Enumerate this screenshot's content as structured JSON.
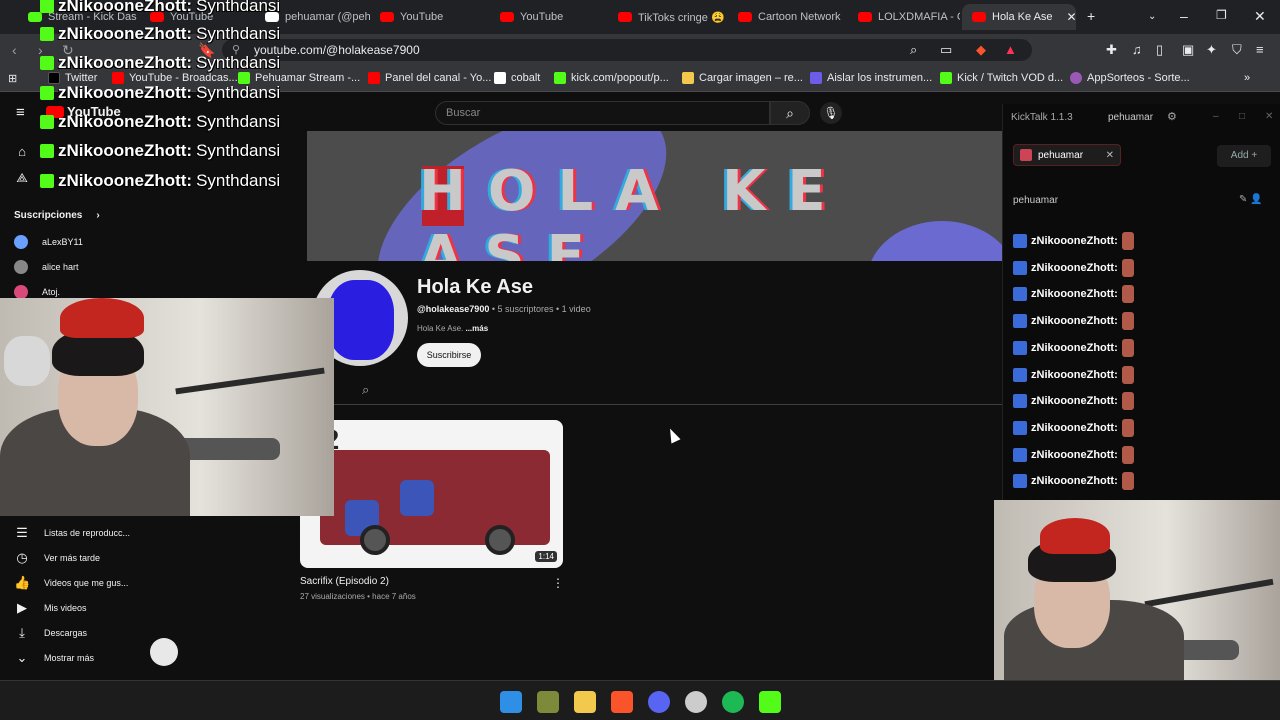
{
  "tabs": [
    {
      "label": "Stream - Kick Das",
      "color": "#53fc18",
      "active": false
    },
    {
      "label": "YouTube",
      "color": "#ff0000",
      "active": false
    },
    {
      "label": "pehuamar (@peh",
      "color": "#ffffff",
      "active": false
    },
    {
      "label": "YouTube",
      "color": "#ff0000",
      "active": false
    },
    {
      "label": "YouTube",
      "color": "#ff0000",
      "active": false
    },
    {
      "label": "TikToks cringe 😩",
      "color": "#ff0000",
      "active": false
    },
    {
      "label": "Cartoon Network",
      "color": "#ff0000",
      "active": false
    },
    {
      "label": "LOLXDMAFIA - C",
      "color": "#ff0000",
      "active": false
    },
    {
      "label": "Hola Ke Ase",
      "color": "#ff0000",
      "active": true
    }
  ],
  "tab_close": "✕",
  "new_tab": "+",
  "address": {
    "url": "youtube.com/@holakease7900"
  },
  "bookmarks": [
    {
      "label": "Twitter",
      "color": "#000000"
    },
    {
      "label": "YouTube - Broadcas...",
      "color": "#ff0000"
    },
    {
      "label": "Pehuamar Stream -...",
      "color": "#53fc18"
    },
    {
      "label": "Panel del canal - Yo...",
      "color": "#ff0000"
    },
    {
      "label": "cobalt",
      "color": "#ffffff"
    },
    {
      "label": "kick.com/popout/p...",
      "color": "#53fc18"
    },
    {
      "label": "Cargar imagen – re...",
      "color": "#f2c94c"
    },
    {
      "label": "Aislar los instrumen...",
      "color": "#6c5ce7"
    },
    {
      "label": "Kick / Twitch VOD d...",
      "color": "#53fc18"
    },
    {
      "label": "AppSorteos - Sorte...",
      "color": "#9b59b6"
    }
  ],
  "youtube": {
    "logo": "YouTube",
    "search_placeholder": "Buscar"
  },
  "overlay": {
    "user": "zNikoooneZhott:",
    "message": "Synthdansi",
    "count": 7
  },
  "sidebar": {
    "subs_title": "Suscripciones",
    "subs": [
      {
        "name": "aLexBY11",
        "color": "#6aa0ff"
      },
      {
        "name": "alice hart",
        "color": "#888888"
      },
      {
        "name": "Atoj.",
        "color": "#d94a7a"
      }
    ],
    "items": [
      {
        "label": "Listas de reproducc...",
        "icon": "playlist-icon"
      },
      {
        "label": "Ver más tarde",
        "icon": "clock-icon"
      },
      {
        "label": "Videos que me gus...",
        "icon": "thumbs-up-icon"
      },
      {
        "label": "Mis videos",
        "icon": "video-icon"
      },
      {
        "label": "Descargas",
        "icon": "download-icon"
      },
      {
        "label": "Mostrar más",
        "icon": "chevron-down-icon"
      }
    ]
  },
  "banner": {
    "text": "HOLA KE ASE"
  },
  "channel": {
    "name": "Hola Ke Ase",
    "handle": "@holakease7900",
    "subscribers": "5 suscriptores",
    "videos": "1 video",
    "description": "Hola Ke Ase.",
    "more": "...más",
    "subscribe_label": "Suscribirse"
  },
  "video": {
    "title": "Sacrifix (Episodio 2)",
    "meta": "27 visualizaciones • hace 7 años",
    "duration": "1:14",
    "thumb_label": "#2"
  },
  "kicktalk": {
    "title": "KickTalk 1.1.3",
    "user": "pehuamar",
    "tab_label": "pehuamar",
    "add_label": "Add +",
    "channel": "pehuamar",
    "message_user": "zNikoooneZhott:",
    "rows": 10
  },
  "taskbar": [
    {
      "name": "windows-start",
      "color": "#2f8fe6"
    },
    {
      "name": "app-2",
      "color": "#7c8a3a"
    },
    {
      "name": "file-explorer",
      "color": "#f2c94c"
    },
    {
      "name": "brave-browser",
      "color": "#fb542b"
    },
    {
      "name": "discord",
      "color": "#5865f2"
    },
    {
      "name": "obs",
      "color": "#cccccc"
    },
    {
      "name": "spotify",
      "color": "#1db954"
    },
    {
      "name": "kick",
      "color": "#53fc18"
    }
  ]
}
